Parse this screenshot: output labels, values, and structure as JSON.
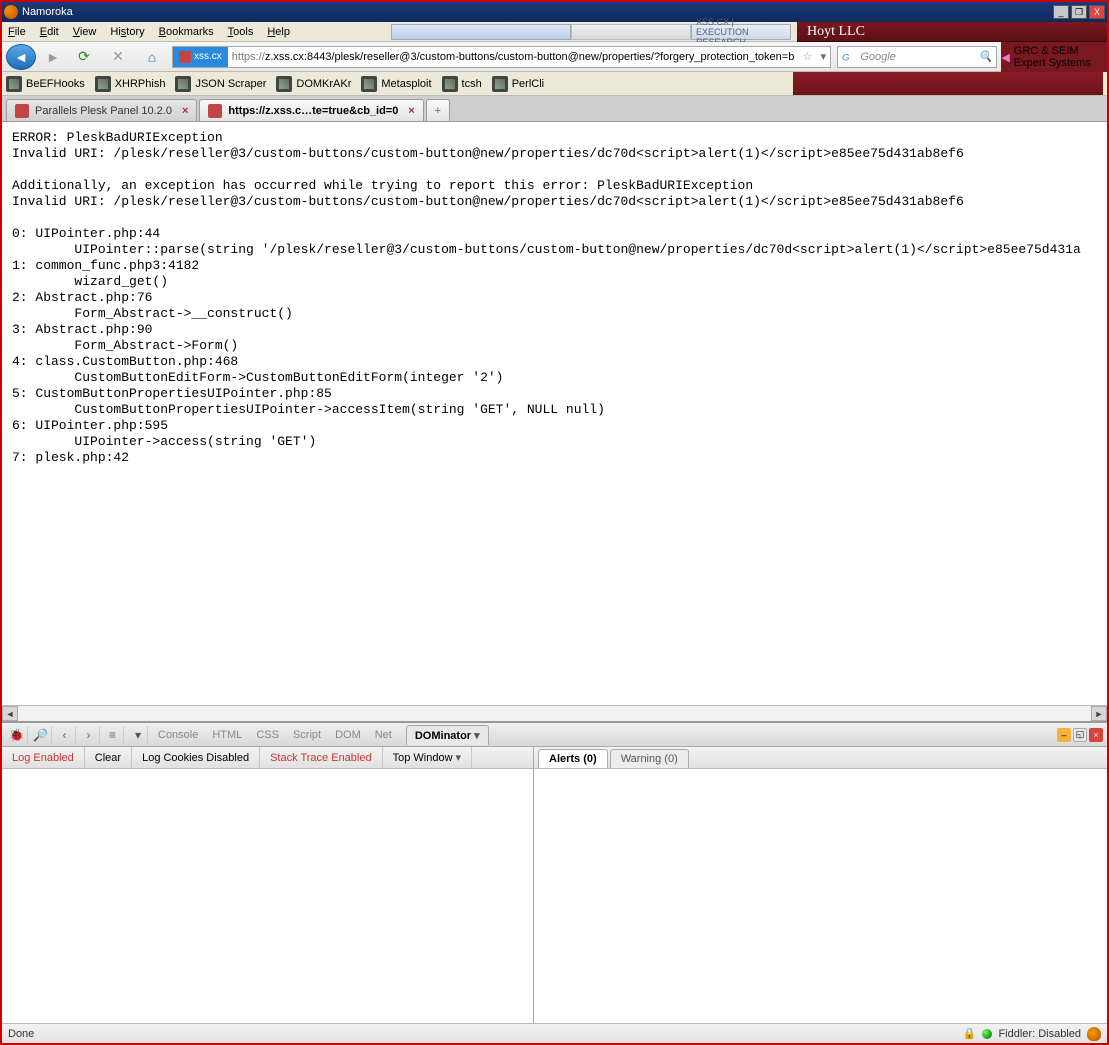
{
  "window": {
    "title": "Namoroka"
  },
  "menu": {
    "items": [
      "File",
      "Edit",
      "View",
      "History",
      "Bookmarks",
      "Tools",
      "Help"
    ],
    "xss_label": "XSS.CX  |  EXECUTION RESEARCH",
    "hoyt": "Hoyt LLC",
    "grc": "GRC & SEIM Expert Systems"
  },
  "nav": {
    "site_id": "xss.cx",
    "url_prefix": "https://",
    "url_rest": "z.xss.cx:8443/plesk/reseller@3/custom-buttons/custom-button@new/properties/?forgery_protection_token=b",
    "search_placeholder": "Google"
  },
  "bookmarks": [
    "BeEFHooks",
    "XHRPhish",
    "JSON Scraper",
    "DOMKrAKr",
    "Metasploit",
    "tcsh",
    "PerlCli"
  ],
  "tabs": {
    "t1": "Parallels Plesk Panel 10.2.0",
    "t2": "https://z.xss.c…te=true&cb_id=0"
  },
  "page_text": "ERROR: PleskBadURIException\nInvalid URI: /plesk/reseller@3/custom-buttons/custom-button@new/properties/dc70d<script>alert(1)</script>e85ee75d431ab8ef6\n\nAdditionally, an exception has occurred while trying to report this error: PleskBadURIException\nInvalid URI: /plesk/reseller@3/custom-buttons/custom-button@new/properties/dc70d<script>alert(1)</script>e85ee75d431ab8ef6\n\n0: UIPointer.php:44\n        UIPointer::parse(string '/plesk/reseller@3/custom-buttons/custom-button@new/properties/dc70d<script>alert(1)</script>e85ee75d431a\n1: common_func.php3:4182\n        wizard_get()\n2: Abstract.php:76\n        Form_Abstract->__construct()\n3: Abstract.php:90\n        Form_Abstract->Form()\n4: class.CustomButton.php:468\n        CustomButtonEditForm->CustomButtonEditForm(integer '2')\n5: CustomButtonPropertiesUIPointer.php:85\n        CustomButtonPropertiesUIPointer->accessItem(string 'GET', NULL null)\n6: UIPointer.php:595\n        UIPointer->access(string 'GET')\n7: plesk.php:42\n",
  "dev": {
    "tabs": [
      "Console",
      "HTML",
      "CSS",
      "Script",
      "DOM",
      "Net"
    ],
    "active_tab": "DOMinator",
    "options": {
      "log": "Log Enabled",
      "clear": "Clear",
      "cookies": "Log Cookies Disabled",
      "stack": "Stack Trace Enabled",
      "window": "Top Window"
    },
    "right_tabs": {
      "alerts": "Alerts (0)",
      "warning": "Warning (0)"
    }
  },
  "status": {
    "left": "Done",
    "fiddler": "Fiddler: Disabled"
  }
}
